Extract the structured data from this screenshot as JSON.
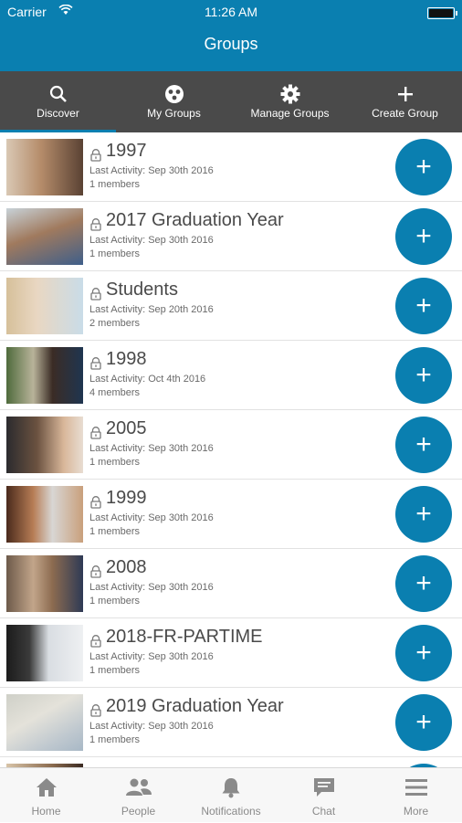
{
  "status_bar": {
    "carrier": "Carrier",
    "time": "11:26 AM"
  },
  "header": {
    "title": "Groups"
  },
  "tabs": [
    {
      "label": "Discover",
      "icon": "search-icon",
      "active": true
    },
    {
      "label": "My Groups",
      "icon": "groups-icon",
      "active": false
    },
    {
      "label": "Manage Groups",
      "icon": "gear-icon",
      "active": false
    },
    {
      "label": "Create Group",
      "icon": "plus-icon",
      "active": false
    }
  ],
  "groups": [
    {
      "name": "1997",
      "last_activity": "Last Activity: Sep 30th 2016",
      "members": "1 members"
    },
    {
      "name": "2017 Graduation Year",
      "last_activity": "Last Activity: Sep 30th 2016",
      "members": "1 members"
    },
    {
      "name": "Students",
      "last_activity": "Last Activity: Sep 20th 2016",
      "members": "2 members"
    },
    {
      "name": "1998",
      "last_activity": "Last Activity: Oct 4th 2016",
      "members": "4 members"
    },
    {
      "name": "2005",
      "last_activity": "Last Activity: Sep 30th 2016",
      "members": "1 members"
    },
    {
      "name": "1999",
      "last_activity": "Last Activity: Sep 30th 2016",
      "members": "1 members"
    },
    {
      "name": "2008",
      "last_activity": "Last Activity: Sep 30th 2016",
      "members": "1 members"
    },
    {
      "name": "2018-FR-PARTIME",
      "last_activity": "Last Activity: Sep 30th 2016",
      "members": "1 members"
    },
    {
      "name": "2019 Graduation Year",
      "last_activity": "Last Activity: Sep 30th 2016",
      "members": "1 members"
    }
  ],
  "bottom_tabs": [
    {
      "label": "Home",
      "icon": "home-icon"
    },
    {
      "label": "People",
      "icon": "people-icon"
    },
    {
      "label": "Notifications",
      "icon": "bell-icon"
    },
    {
      "label": "Chat",
      "icon": "chat-icon"
    },
    {
      "label": "More",
      "icon": "menu-icon"
    }
  ],
  "colors": {
    "accent": "#0a7fb0",
    "tab_bar": "#4a4a4a",
    "bottom_bar": "#f7f7f7"
  }
}
